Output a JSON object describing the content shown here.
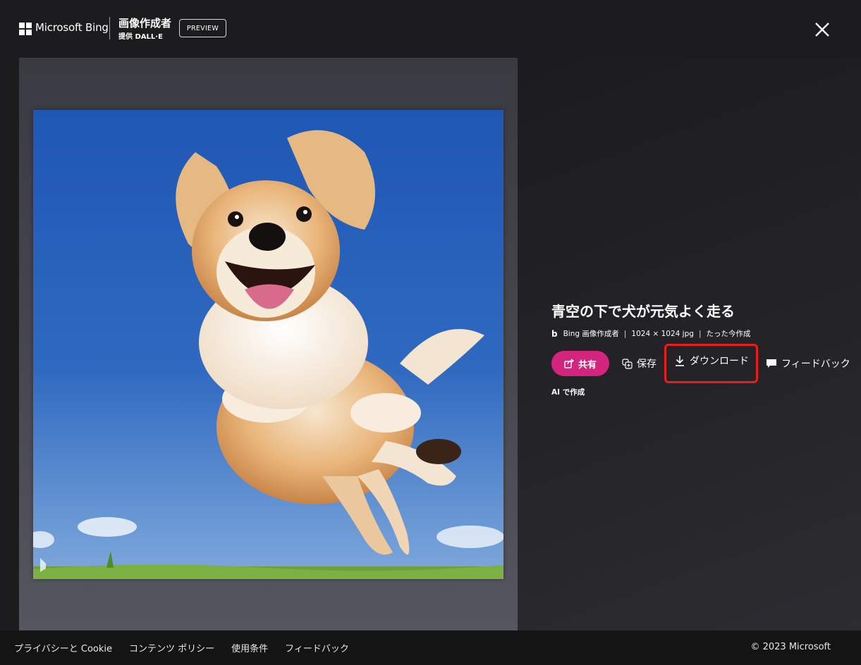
{
  "header": {
    "brand": "Microsoft Bing",
    "product_title": "画像作成者",
    "product_subtitle": "提供 DALL·E",
    "badge": "PREVIEW",
    "close_icon": "close-icon"
  },
  "image": {
    "title": "青空の下で犬が元気よく走る",
    "meta": {
      "source": "Bing 画像作成者",
      "dimensions": "1024 × 1024 jpg",
      "created": "たった今作成"
    },
    "ai_label": "AI で作成",
    "watermark_icon": "bing-watermark-icon"
  },
  "actions": {
    "share": "共有",
    "save": "保存",
    "download": "ダウンロード",
    "feedback": "フィードバック"
  },
  "colors": {
    "share_button": "#d3247f",
    "highlight_box": "#ec1c1c",
    "sky": "#2f69c0"
  },
  "footer": {
    "links": [
      "プライバシーと Cookie",
      "コンテンツ ポリシー",
      "使用条件",
      "フィードバック"
    ],
    "copyright": "© 2023 Microsoft"
  }
}
